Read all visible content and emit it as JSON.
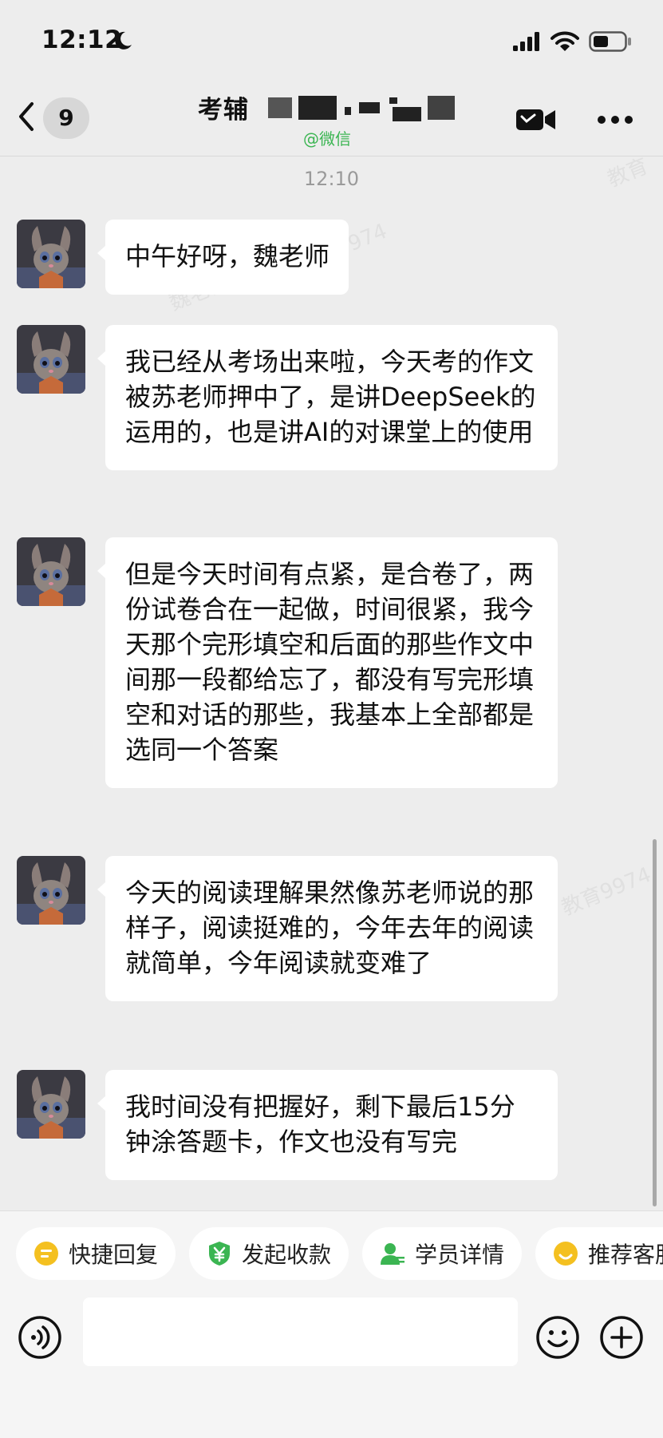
{
  "status_bar": {
    "time": "12:12"
  },
  "header": {
    "unread_count": "9",
    "title": "考辅",
    "subtitle": "@微信"
  },
  "chat": {
    "timestamp": "12:10",
    "messages": [
      {
        "text": "中午好呀，魏老师"
      },
      {
        "text": "我已经从考场出来啦，今天考的作文被苏老师押中了，是讲DeepSeek的运用的，也是讲AI的对课堂上的使用"
      },
      {
        "text": "但是今天时间有点紧，是合卷了，两份试卷合在一起做，时间很紧，我今天那个完形填空和后面的那些作文中间那一段都给忘了，都没有写完形填空和对话的那些，我基本上全部都是选同一个答案"
      },
      {
        "text": "今天的阅读理解果然像苏老师说的那样子，阅读挺难的，今年去年的阅读就简单，今年阅读就变难了"
      },
      {
        "text": "我时间没有把握好，剩下最后15分钟涂答题卡，作文也没有写完"
      }
    ]
  },
  "quick_actions": [
    {
      "label": "快捷回复",
      "icon": "quick-reply-icon"
    },
    {
      "label": "发起收款",
      "icon": "payment-icon"
    },
    {
      "label": "学员详情",
      "icon": "student-icon"
    },
    {
      "label": "推荐客服",
      "icon": "recommend-icon"
    }
  ],
  "input": {
    "value": ""
  },
  "colors": {
    "background": "#ededed",
    "bubble": "#ffffff",
    "accent_green": "#3bb552",
    "chip_yellow": "#f4c020"
  }
}
